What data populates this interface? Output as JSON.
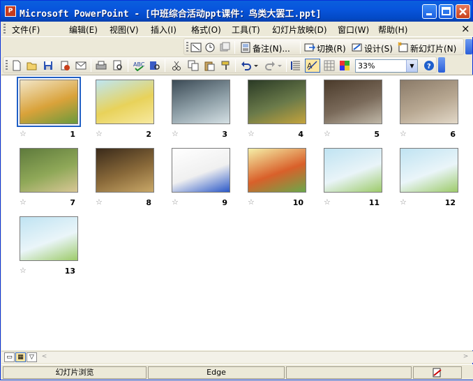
{
  "window": {
    "title": "Microsoft PowerPoint - [中班综合活动ppt课件：鸟类大罢工.ppt]",
    "app_icon_text": "P"
  },
  "menubar": {
    "items": [
      "文件(F)",
      "编辑(E)",
      "视图(V)",
      "插入(I)",
      "格式(O)",
      "工具(T)",
      "幻灯片放映(D)",
      "窗口(W)",
      "帮助(H)"
    ],
    "close_glyph": "×"
  },
  "toolbar_top": {
    "notes_label": "备注(N)...",
    "transition_label": "切换(R)",
    "design_label": "设计(S)",
    "new_slide_label": "新幻灯片(N)"
  },
  "toolbar_main": {
    "zoom_value": "33%"
  },
  "slides": [
    {
      "num": "1",
      "colors": [
        "#F2E6C8",
        "#D9A23A",
        "#6A9A3C"
      ],
      "selected": true
    },
    {
      "num": "2",
      "colors": [
        "#BEE6F3",
        "#E8D25A",
        "#F7E9A0"
      ],
      "selected": false
    },
    {
      "num": "3",
      "colors": [
        "#3B4A55",
        "#8FA0A8",
        "#D5E0E4"
      ],
      "selected": false
    },
    {
      "num": "4",
      "colors": [
        "#2A3A25",
        "#6A7A4A",
        "#C4A33C"
      ],
      "selected": false
    },
    {
      "num": "5",
      "colors": [
        "#4A3A2A",
        "#7A6A5A",
        "#C0B8A8"
      ],
      "selected": false
    },
    {
      "num": "6",
      "colors": [
        "#8A7A68",
        "#B7A791",
        "#E2D8C8"
      ],
      "selected": false
    },
    {
      "num": "7",
      "colors": [
        "#5E7A3C",
        "#8FA858",
        "#D9C796"
      ],
      "selected": false
    },
    {
      "num": "8",
      "colors": [
        "#3A2A1A",
        "#8A6A3A",
        "#C9A868"
      ],
      "selected": false
    },
    {
      "num": "9",
      "colors": [
        "#FFFFFF",
        "#F0F0F0",
        "#2A58C8"
      ],
      "selected": false
    },
    {
      "num": "10",
      "colors": [
        "#F5F0A8",
        "#D9602A",
        "#6AA84A"
      ],
      "selected": false
    },
    {
      "num": "11",
      "colors": [
        "#BFE3F2",
        "#E9F4F8",
        "#9DCB6A"
      ],
      "selected": false
    },
    {
      "num": "12",
      "colors": [
        "#BFE3F2",
        "#EAF5F9",
        "#9DCB6A"
      ],
      "selected": false
    },
    {
      "num": "13",
      "colors": [
        "#BFE3F2",
        "#EAF5F9",
        "#9DCB6A"
      ],
      "selected": false
    }
  ],
  "statusbar": {
    "view_name": "幻灯片浏览",
    "design_name": "Edge"
  }
}
